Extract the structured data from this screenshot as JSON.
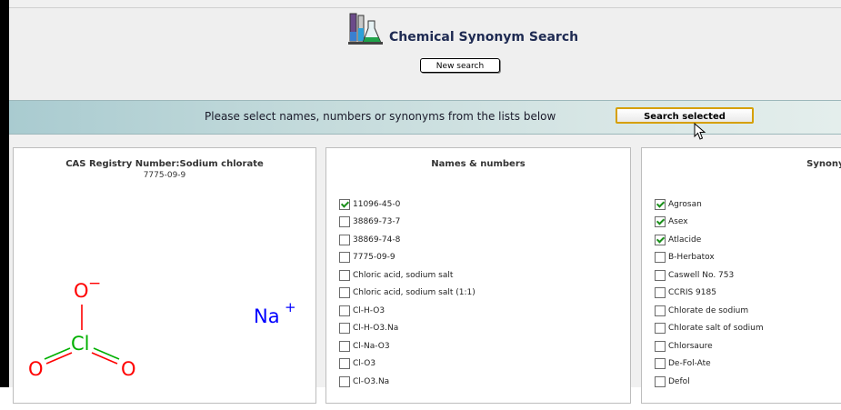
{
  "header": {
    "title": "Chemical Synonym Search",
    "new_search_label": "New search"
  },
  "bar": {
    "instruction": "Please select names, numbers or synonyms from the lists below",
    "search_selected_label": "Search selected"
  },
  "structure_panel": {
    "heading": "CAS Registry Number:Sodium chlorate",
    "cas": "7775-09-9",
    "molecule": {
      "atoms": {
        "o_top": "O",
        "cl": "Cl",
        "o_left": "O",
        "o_right": "O",
        "na": "Na"
      },
      "charges": {
        "o_top": "−",
        "na": "+"
      },
      "colors": {
        "oxygen": "#ff0000",
        "chlorine": "#00b000",
        "sodium": "#0000ff"
      }
    }
  },
  "names_panel": {
    "heading": "Names & numbers",
    "items": [
      {
        "label": "11096-45-0",
        "checked": true
      },
      {
        "label": "38869-73-7",
        "checked": false
      },
      {
        "label": "38869-74-8",
        "checked": false
      },
      {
        "label": "7775-09-9",
        "checked": false
      },
      {
        "label": "Chloric acid, sodium salt",
        "checked": false
      },
      {
        "label": "Chloric acid, sodium salt (1:1)",
        "checked": false
      },
      {
        "label": "Cl-H-O3",
        "checked": false
      },
      {
        "label": "Cl-H-O3.Na",
        "checked": false
      },
      {
        "label": "Cl-Na-O3",
        "checked": false
      },
      {
        "label": "Cl-O3",
        "checked": false
      },
      {
        "label": "Cl-O3.Na",
        "checked": false
      }
    ]
  },
  "synonyms_panel": {
    "heading": "Synonyms",
    "items": [
      {
        "label": "Agrosan",
        "checked": true
      },
      {
        "label": "Asex",
        "checked": true
      },
      {
        "label": "Atlacide",
        "checked": true
      },
      {
        "label": "B-Herbatox",
        "checked": false
      },
      {
        "label": "Caswell No. 753",
        "checked": false
      },
      {
        "label": "CCRIS 9185",
        "checked": false
      },
      {
        "label": "Chlorate de sodium",
        "checked": false
      },
      {
        "label": "Chlorate salt of sodium",
        "checked": false
      },
      {
        "label": "Chlorsaure",
        "checked": false
      },
      {
        "label": "De-Fol-Ate",
        "checked": false
      },
      {
        "label": "Defol",
        "checked": false
      }
    ]
  },
  "icons": {
    "logo": "lab-flasks-icon",
    "cursor": "mouse-pointer-icon",
    "checkbox": "checkbox-icon"
  }
}
